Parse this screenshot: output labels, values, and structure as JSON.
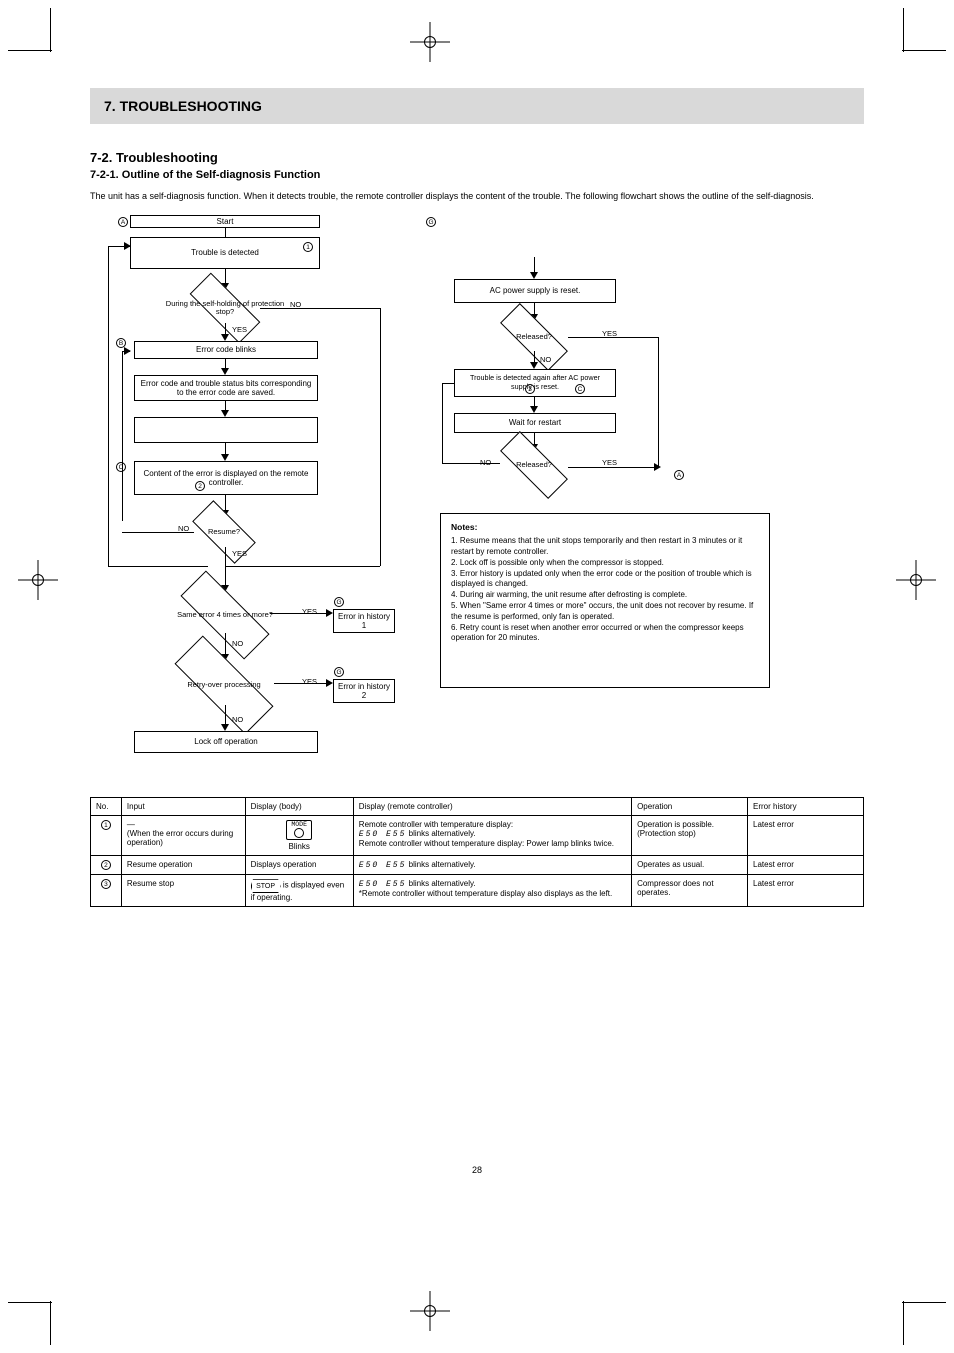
{
  "title": "7. TROUBLESHOOTING",
  "section_number": "7-2.",
  "section_title": "Troubleshooting",
  "subsection": "7-2-1. Outline of the Self-diagnosis Function",
  "intro": "The unit has a self-diagnosis function. When it detects trouble, the remote controller displays the content of the trouble. The following flowchart shows the outline of the self-diagnosis.",
  "flow": {
    "A": "A",
    "start": "Start",
    "circ1": "1",
    "trouble_is_detected": "Trouble is detected",
    "B": "B",
    "error_code_blinks": "Error code blinks",
    "status_bits_saved": "Error code and trouble status bits corresponding to the error code are saved.",
    "resume_stop_q": "During the self-holding of protection stop?",
    "C_marker": "C",
    "display_remote": "Content of the error is displayed on the remote controller.",
    "circ2": "2",
    "resume_q": "Resume?",
    "same_error_q": "Same error 4 times or more?",
    "history1": "Error in history 1",
    "retry_over_q": "Retry-over processing",
    "history2": "Error in history 2",
    "lock_off": "Lock off operation"
  },
  "flow_right": {
    "G_marker": "G",
    "ac_reset": "AC power supply is reset.",
    "release1": "Released?",
    "trouble_again": "Trouble is detected again after AC power supply is reset.",
    "circ3": "3",
    "C_on_line": "C",
    "wait_restart": "Wait for restart",
    "release2": "Released?",
    "to_A": "A"
  },
  "flow_labels": {
    "NO": "NO",
    "YES": "YES"
  },
  "notes": {
    "heading": "Notes:",
    "n1": "Resume means that the unit stops temporarily and then restart in 3 minutes or it restart by remote controller.",
    "n2": "Lock off is possible only when the compressor is stopped.",
    "n3": "Error history is updated only when the error code or the position of trouble which is displayed is changed.",
    "n4": "During air warming, the unit resume after defrosting is complete.",
    "n5": "When \"Same error 4 times or more\" occurs, the unit does not recover by resume. If the resume is performed, only fan is operated.",
    "n6": "Retry count is reset when another error occurred or when the compressor keeps operation for 20 minutes."
  },
  "table": {
    "headers": {
      "no": "No.",
      "input": "Input",
      "display_body": "Display (body)",
      "display_remote": "Display (remote controller)",
      "operation": "Operation",
      "error_history": "Error history"
    },
    "rows": [
      {
        "no": "1",
        "input_line1": "—",
        "input_line2": "(When the error occurs during operation)",
        "display_body_glyph_label": "MODE",
        "display_body_text": "Blinks",
        "remote_line1": "Remote controller with temperature display:",
        "remote_seg": "E50 E55",
        "remote_line2": "blinks alternatively.",
        "remote_line3": "Remote controller without temperature display: Power lamp blinks twice.",
        "operation": "Operation is possible. (Protection stop)",
        "history": "Latest error"
      },
      {
        "no": "2",
        "input": "Resume operation",
        "display_body": "Displays operation",
        "remote_seg": "E50 E55",
        "remote_line2": "blinks alternatively.",
        "operation": "Operates as usual.",
        "history": "Latest error"
      },
      {
        "no": "3",
        "input": "Resume stop",
        "display_body_hex": "STOP",
        "display_body_text": "is displayed even if operating.",
        "remote_seg": "E50 E55",
        "remote_line2": "blinks alternatively.",
        "remote_line3": "*Remote controller without temperature display also displays as the left.",
        "operation": "Compressor does not operates.",
        "history": "Latest error"
      }
    ]
  },
  "page_number": "28"
}
